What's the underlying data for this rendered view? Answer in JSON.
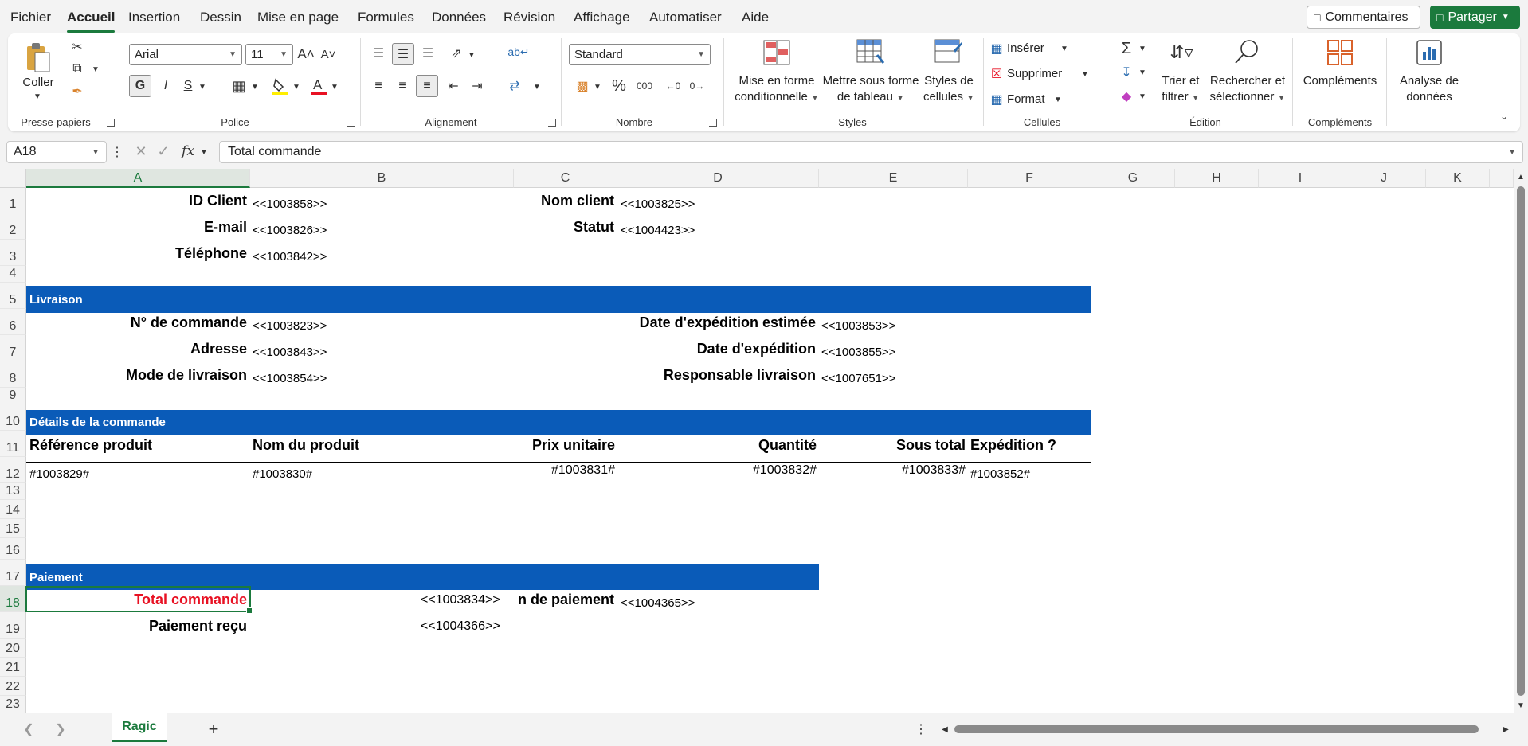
{
  "menubar": {
    "items": [
      "Fichier",
      "Accueil",
      "Insertion",
      "Dessin",
      "Mise en page",
      "Formules",
      "Données",
      "Révision",
      "Affichage",
      "Automatiser",
      "Aide"
    ],
    "active": "Accueil",
    "comments": "Commentaires",
    "share": "Partager"
  },
  "ribbon": {
    "clipboard": {
      "paste": "Coller",
      "group": "Presse-papiers"
    },
    "font": {
      "name": "Arial",
      "size": "11",
      "bold": "G",
      "italic": "I",
      "underline": "S",
      "group": "Police"
    },
    "alignment": {
      "group": "Alignement"
    },
    "number": {
      "format": "Standard",
      "group": "Nombre"
    },
    "styles": {
      "cond_format_1": "Mise en forme",
      "cond_format_2": "conditionnelle",
      "table_1": "Mettre sous forme",
      "table_2": "de tableau",
      "cell_styles_1": "Styles de",
      "cell_styles_2": "cellules",
      "group": "Styles"
    },
    "cells": {
      "insert": "Insérer",
      "delete": "Supprimer",
      "format": "Format",
      "group": "Cellules"
    },
    "editing": {
      "sort_1": "Trier et",
      "sort_2": "filtrer",
      "find_1": "Rechercher et",
      "find_2": "sélectionner",
      "group": "Édition"
    },
    "addins": {
      "label": "Compléments",
      "group": "Compléments"
    },
    "analysis": {
      "label_1": "Analyse de",
      "label_2": "données"
    }
  },
  "formula_bar": {
    "name_box": "A18",
    "content": "Total commande"
  },
  "columns": [
    "A",
    "B",
    "C",
    "D",
    "E",
    "F",
    "G",
    "H",
    "I",
    "J",
    "K"
  ],
  "rows": [
    "1",
    "2",
    "3",
    "4",
    "5",
    "6",
    "7",
    "8",
    "9",
    "10",
    "11",
    "12",
    "13",
    "14",
    "15",
    "16",
    "17",
    "18",
    "19",
    "20",
    "21",
    "22",
    "23"
  ],
  "sheet": {
    "r1": {
      "a": "ID Client",
      "b": "<<1003858>>",
      "c": "Nom client",
      "d": "<<1003825>>"
    },
    "r2": {
      "a": "E-mail",
      "b": "<<1003826>>",
      "c": "Statut",
      "d": "<<1004423>>"
    },
    "r3": {
      "a": "Téléphone",
      "b": "<<1003842>>"
    },
    "r5": {
      "band": "Livraison"
    },
    "r6": {
      "a": "N° de commande",
      "b": "<<1003823>>",
      "d": "Date d'expédition estimée",
      "e": "<<1003853>>"
    },
    "r7": {
      "a": "Adresse",
      "b": "<<1003843>>",
      "d": "Date d'expédition",
      "e": "<<1003855>>"
    },
    "r8": {
      "a": "Mode de livraison",
      "b": "<<1003854>>",
      "d": "Responsable livraison",
      "e": "<<1007651>>"
    },
    "r10": {
      "band": "Détails de la commande"
    },
    "r11": {
      "a": "Référence produit",
      "b": "Nom du produit",
      "c": "Prix unitaire",
      "d": "Quantité",
      "e": "Sous total",
      "f": "Expédition ?"
    },
    "r12": {
      "a": "#1003829#",
      "b": "#1003830#",
      "c": "#1003831#",
      "d": "#1003832#",
      "e": "#1003833#",
      "f": "#1003852#"
    },
    "r17": {
      "band": "Paiement"
    },
    "r18": {
      "a": "Total commande",
      "b": "<<1003834>>",
      "c": "n de paiement",
      "d": "<<1004365>>"
    },
    "r19": {
      "a": "Paiement reçu",
      "b": "<<1004366>>"
    }
  },
  "tabs": {
    "sheet_name": "Ragic"
  },
  "colors": {
    "accent": "#1b7a3d",
    "band": "#0a5bb8",
    "red_text": "#e81123"
  }
}
